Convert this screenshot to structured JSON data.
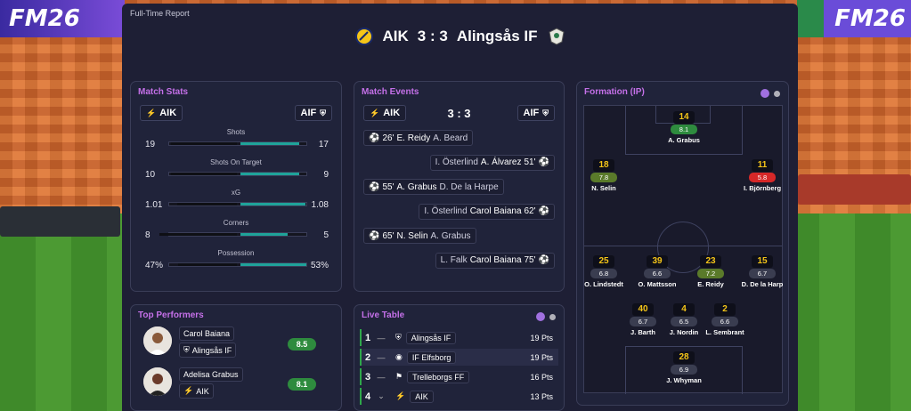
{
  "banner": {
    "left": "FM26",
    "right": "FM26"
  },
  "report_label": "Full-Time Report",
  "match": {
    "home": "AIK",
    "score": "3 : 3",
    "away": "Alingsås IF"
  },
  "match_stats": {
    "title": "Match Stats",
    "home_chip": "AIK",
    "away_chip": "AIF",
    "stats": [
      {
        "label": "Shots",
        "home": "19",
        "away": "17",
        "home_frac": 0.53,
        "away_frac": 0.47
      },
      {
        "label": "Shots On Target",
        "home": "10",
        "away": "9",
        "home_frac": 0.53,
        "away_frac": 0.47
      },
      {
        "label": "xG",
        "home": "1.01",
        "away": "1.08",
        "home_frac": 0.48,
        "away_frac": 0.52
      },
      {
        "label": "Corners",
        "home": "8",
        "away": "5",
        "home_frac": 0.62,
        "away_frac": 0.38
      },
      {
        "label": "Possession",
        "home": "47%",
        "away": "53%",
        "home_frac": 0.47,
        "away_frac": 0.53
      }
    ]
  },
  "match_events": {
    "title": "Match Events",
    "home_chip": "AIK",
    "score": "3 : 3",
    "away_chip": "AIF",
    "events": [
      {
        "side": "home",
        "minute": "26'",
        "scorer": "E. Reidy",
        "assist": "A. Beard"
      },
      {
        "side": "away",
        "minute": "51'",
        "scorer": "A. Álvarez",
        "assist": "I. Österlind"
      },
      {
        "side": "home",
        "minute": "55'",
        "scorer": "A. Grabus",
        "assist": "D. De la Harpe"
      },
      {
        "side": "away",
        "minute": "62'",
        "scorer": "Carol Baiana",
        "assist": "I. Österlind"
      },
      {
        "side": "home",
        "minute": "65'",
        "scorer": "N. Selin",
        "assist": "A. Grabus"
      },
      {
        "side": "away",
        "minute": "75'",
        "scorer": "Carol Baiana",
        "assist": "L. Falk"
      }
    ]
  },
  "formation": {
    "title": "Formation (IP)",
    "players": [
      {
        "num": "14",
        "rating": "8.1",
        "name": "A. Grabus",
        "color": "#2e8b3e"
      },
      {
        "num": "18",
        "rating": "7.8",
        "name": "N. Selin",
        "color": "#5a7a2a"
      },
      {
        "num": "11",
        "rating": "5.8",
        "name": "I. Björnberg",
        "color": "#d62828"
      },
      {
        "num": "25",
        "rating": "6.8",
        "name": "O. Lindstedt",
        "color": "#3a3d50"
      },
      {
        "num": "39",
        "rating": "6.6",
        "name": "O. Mattsson",
        "color": "#3a3d50"
      },
      {
        "num": "23",
        "rating": "7.2",
        "name": "E. Reidy",
        "color": "#5a7a2a"
      },
      {
        "num": "15",
        "rating": "6.7",
        "name": "D. De la Harp",
        "color": "#3a3d50"
      },
      {
        "num": "40",
        "rating": "6.7",
        "name": "J. Barth",
        "color": "#3a3d50"
      },
      {
        "num": "4",
        "rating": "6.5",
        "name": "J. Nordin",
        "color": "#3a3d50"
      },
      {
        "num": "2",
        "rating": "6.6",
        "name": "L. Sembrant",
        "color": "#3a3d50"
      },
      {
        "num": "28",
        "rating": "6.9",
        "name": "J. Whyman",
        "color": "#3a3d50"
      }
    ]
  },
  "top_performers": {
    "title": "Top Performers",
    "items": [
      {
        "name": "Carol Baiana",
        "club": "Alingsås IF",
        "rating": "8.5"
      },
      {
        "name": "Adelisa Grabus",
        "club": "AIK",
        "rating": "8.1"
      }
    ]
  },
  "live_table": {
    "title": "Live Table",
    "rows": [
      {
        "pos": "1",
        "move": "—",
        "club": "Alingsås IF",
        "pts": "19 Pts",
        "bar": "#2ea84a"
      },
      {
        "pos": "2",
        "move": "—",
        "club": "IF Elfsborg",
        "pts": "19 Pts",
        "bar": "#2ea84a"
      },
      {
        "pos": "3",
        "move": "—",
        "club": "Trelleborgs FF",
        "pts": "16 Pts",
        "bar": "#2ea84a"
      },
      {
        "pos": "4",
        "move": "⌄",
        "club": "AIK",
        "pts": "13 Pts",
        "bar": "#2ea84a"
      }
    ]
  },
  "colors": {
    "accent": "#c470e8",
    "home_bar": "#0e0f14",
    "away_bar": "#1fa39a",
    "rating_green": "#2e8b3e",
    "toggle_active": "#a070e0",
    "toggle_inactive": "#b0b0b8"
  }
}
